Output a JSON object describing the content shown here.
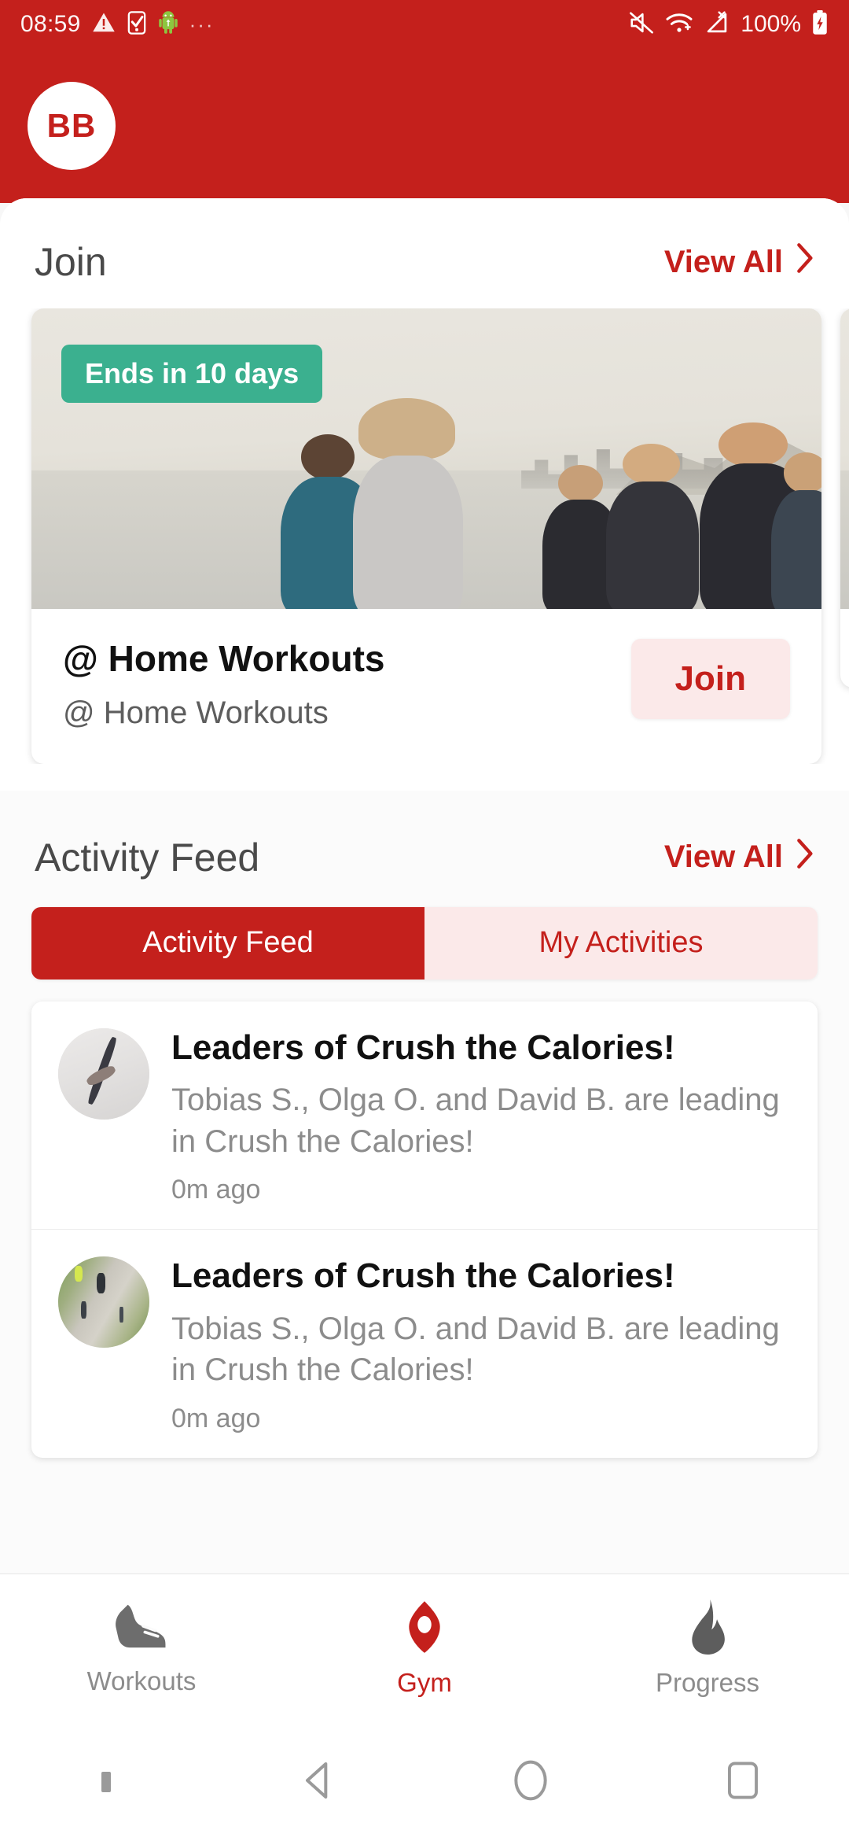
{
  "status_bar": {
    "time": "08:59",
    "battery_percent": "100%",
    "icons": [
      "warning-triangle-icon",
      "sim-card-check-icon",
      "android-robot-icon",
      "overflow-dots-icon",
      "mute-icon",
      "wifi-icon",
      "no-signal-icon",
      "battery-charging-icon"
    ]
  },
  "header": {
    "avatar_initials": "BB"
  },
  "join_section": {
    "title": "Join",
    "view_all": "View All",
    "cards": [
      {
        "badge": "Ends in 10 days",
        "title": "@ Home Workouts",
        "subtitle": "@ Home Workouts",
        "action_label": "Join"
      },
      {
        "badge": "",
        "title": "",
        "subtitle": "",
        "action_label": ""
      }
    ]
  },
  "activity_section": {
    "title": "Activity Feed",
    "view_all": "View All",
    "tabs": [
      {
        "label": "Activity Feed",
        "active": true
      },
      {
        "label": "My Activities",
        "active": false
      }
    ],
    "items": [
      {
        "title": "Leaders of Crush the Calories!",
        "description": "Tobias S., Olga O. and David B. are leading in Crush the Calories!",
        "time": "0m ago",
        "thumb": "yoga-stretch-photo"
      },
      {
        "title": "Leaders of Crush the Calories!",
        "description": "Tobias S., Olga O. and David B. are leading in Crush the Calories!",
        "time": "0m ago",
        "thumb": "runners-on-path-photo"
      }
    ]
  },
  "tab_bar": {
    "items": [
      {
        "label": "Workouts",
        "icon": "shoe-icon",
        "active": false
      },
      {
        "label": "Gym",
        "icon": "location-pin-icon",
        "active": true
      },
      {
        "label": "Progress",
        "icon": "flame-icon",
        "active": false
      }
    ]
  },
  "nav_bar": {
    "items": [
      "marker-dot",
      "back-triangle-icon",
      "home-circle-icon",
      "recents-square-icon"
    ]
  },
  "colors": {
    "brand_red": "#C4201C",
    "badge_green": "#3BB08F",
    "light_pink": "#FBE9E9",
    "muted_gray": "#8C8C8C"
  }
}
